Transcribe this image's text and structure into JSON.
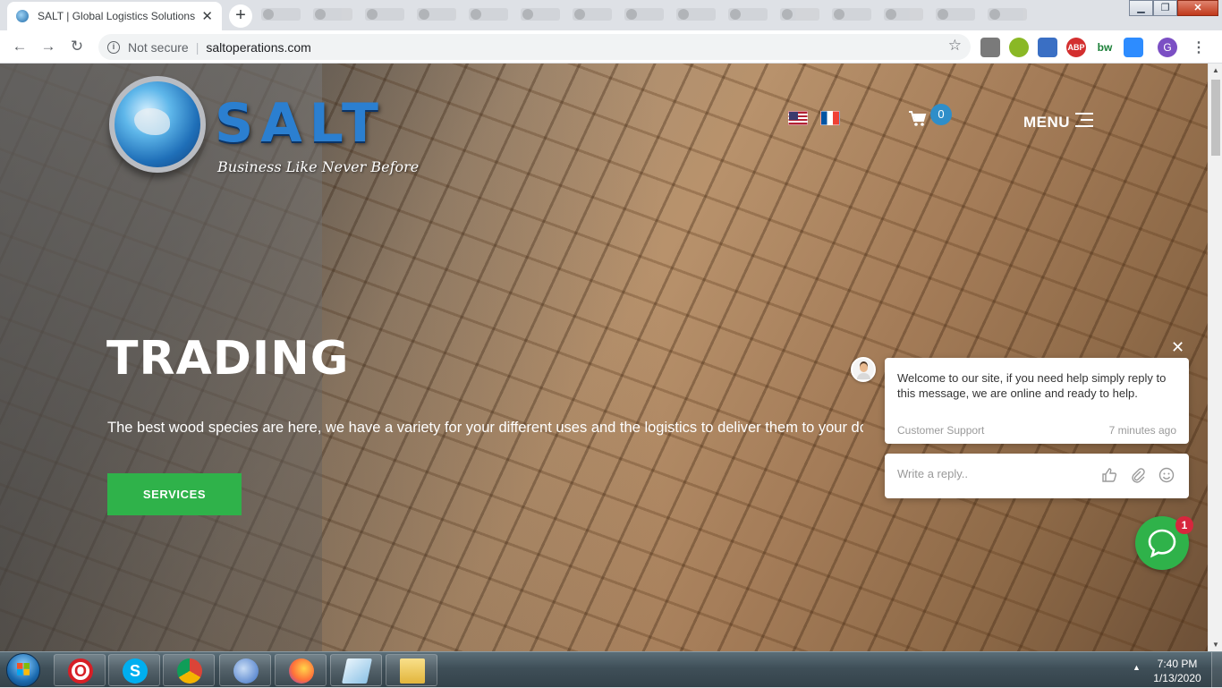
{
  "browser": {
    "tab_title": "SALT | Global Logistics Solutions",
    "new_tab_symbol": "+",
    "security_label": "Not secure",
    "url": "saltoperations.com",
    "profile_initial": "G",
    "extensions": [
      {
        "name": "camera-extension-icon",
        "label": "",
        "color": "#7a7a7a"
      },
      {
        "name": "green-extension-icon",
        "label": "",
        "color": "#8ab825"
      },
      {
        "name": "download-extension-icon",
        "label": "",
        "color": "#3a6fc4"
      },
      {
        "name": "adblock-plus-icon",
        "label": "ABP",
        "color": "#d32f2f"
      },
      {
        "name": "bw-extension-icon",
        "label": "bw",
        "color": "#1a7f37"
      },
      {
        "name": "zoom-extension-icon",
        "label": "",
        "color": "#2d8cff"
      }
    ]
  },
  "site": {
    "logo_text": "SALT",
    "logo_tagline": "Business Like Never Before",
    "cart_count": "0",
    "menu_label": "MENU",
    "hero_title": "TRADING",
    "hero_subtitle": "The best wood species are here, we have a variety for your different uses and the logistics to deliver them to your do",
    "services_button": "SERVICES"
  },
  "chat": {
    "close_symbol": "✕",
    "message": "Welcome to our site, if you need help simply reply to this message, we are online and ready to help.",
    "sender": "Customer Support",
    "time": "7 minutes ago",
    "reply_placeholder": "Write a reply..",
    "unread_count": "1"
  },
  "taskbar": {
    "apps": [
      {
        "name": "opera-taskbar-icon",
        "label": "O",
        "color": "#d71f26"
      },
      {
        "name": "skype-taskbar-icon",
        "label": "S",
        "color": "#00aff0"
      },
      {
        "name": "chrome-taskbar-icon",
        "label": "",
        "color": "#4caf50"
      },
      {
        "name": "thunderbird-taskbar-icon",
        "label": "",
        "color": "#3a6fc4"
      },
      {
        "name": "firefox-taskbar-icon",
        "label": "",
        "color": "#ff7139"
      },
      {
        "name": "notepad-taskbar-icon",
        "label": "",
        "color": "#9ec9e8"
      },
      {
        "name": "explorer-taskbar-icon",
        "label": "",
        "color": "#f4c542"
      }
    ],
    "time": "7:40 PM",
    "date": "1/13/2020"
  }
}
